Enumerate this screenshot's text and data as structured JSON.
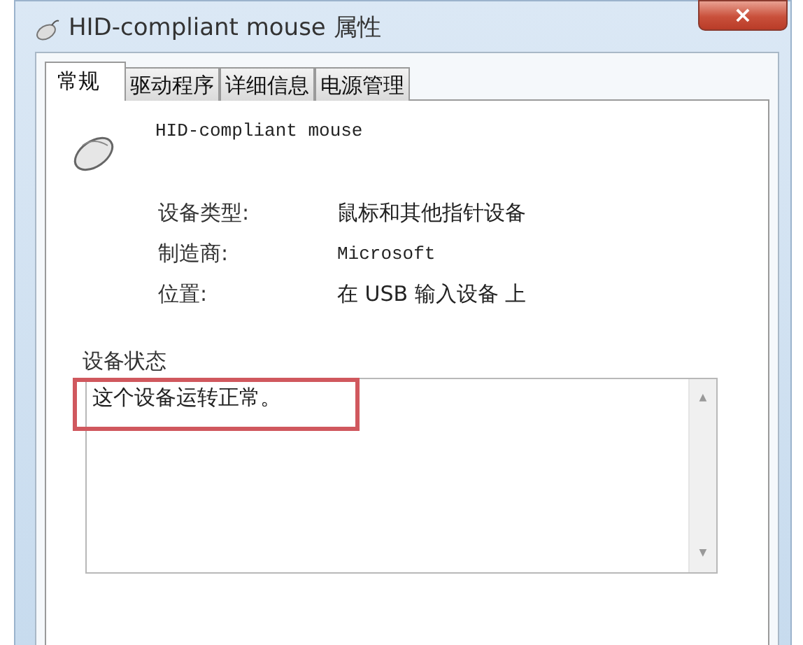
{
  "window": {
    "title": "HID-compliant mouse 属性",
    "close": "×"
  },
  "tabs": [
    {
      "label": "常规",
      "selected": true
    },
    {
      "label": "驱动程序",
      "selected": false
    },
    {
      "label": "详细信息",
      "selected": false
    },
    {
      "label": "电源管理",
      "selected": false
    }
  ],
  "device": {
    "name": "HID-compliant mouse"
  },
  "properties": [
    {
      "label": "设备类型:",
      "value": "鼠标和其他指针设备",
      "kind": "text"
    },
    {
      "label": "制造商:",
      "value": "Microsoft",
      "kind": "mono"
    },
    {
      "label": "位置:",
      "value": "在 USB 输入设备 上",
      "kind": "text"
    }
  ],
  "status": {
    "title": "设备状态",
    "text": "这个设备运转正常。",
    "scroll_up": "▲",
    "scroll_down": "▼"
  }
}
